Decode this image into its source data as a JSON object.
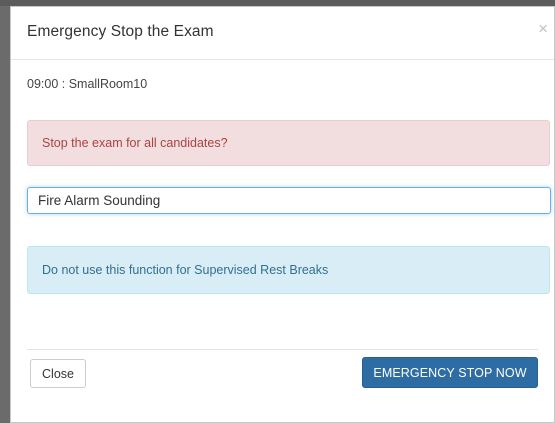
{
  "modal": {
    "title": "Emergency Stop the Exam",
    "close_icon": "×",
    "session": "09:00 : SmallRoom10",
    "warning": "Stop the exam for all candidates?",
    "reason_value": "Fire Alarm Sounding",
    "info": "Do not use this function for Supervised Rest Breaks",
    "close_button": "Close",
    "stop_button": "EMERGENCY STOP NOW"
  },
  "colors": {
    "primary": "#2e6da4",
    "danger_bg": "#f2dede",
    "danger_text": "#a94442",
    "info_bg": "#d9edf7",
    "info_text": "#31708f",
    "focus": "#66afe9"
  }
}
